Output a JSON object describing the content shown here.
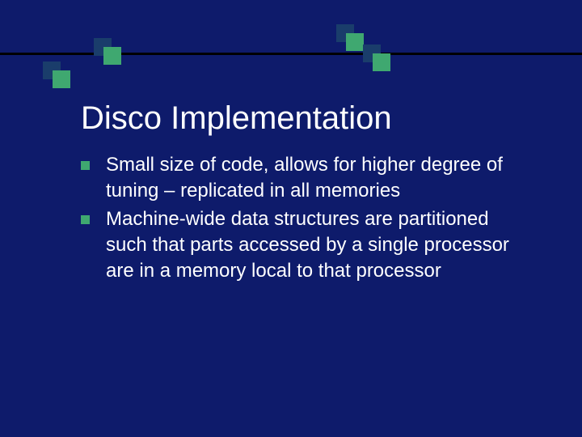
{
  "title": "Disco Implementation",
  "bullets": [
    "Small size of code, allows for higher degree of tuning – replicated in all memories",
    "Machine-wide data structures are partitioned such that parts accessed by a single processor are in a memory local to that processor"
  ]
}
